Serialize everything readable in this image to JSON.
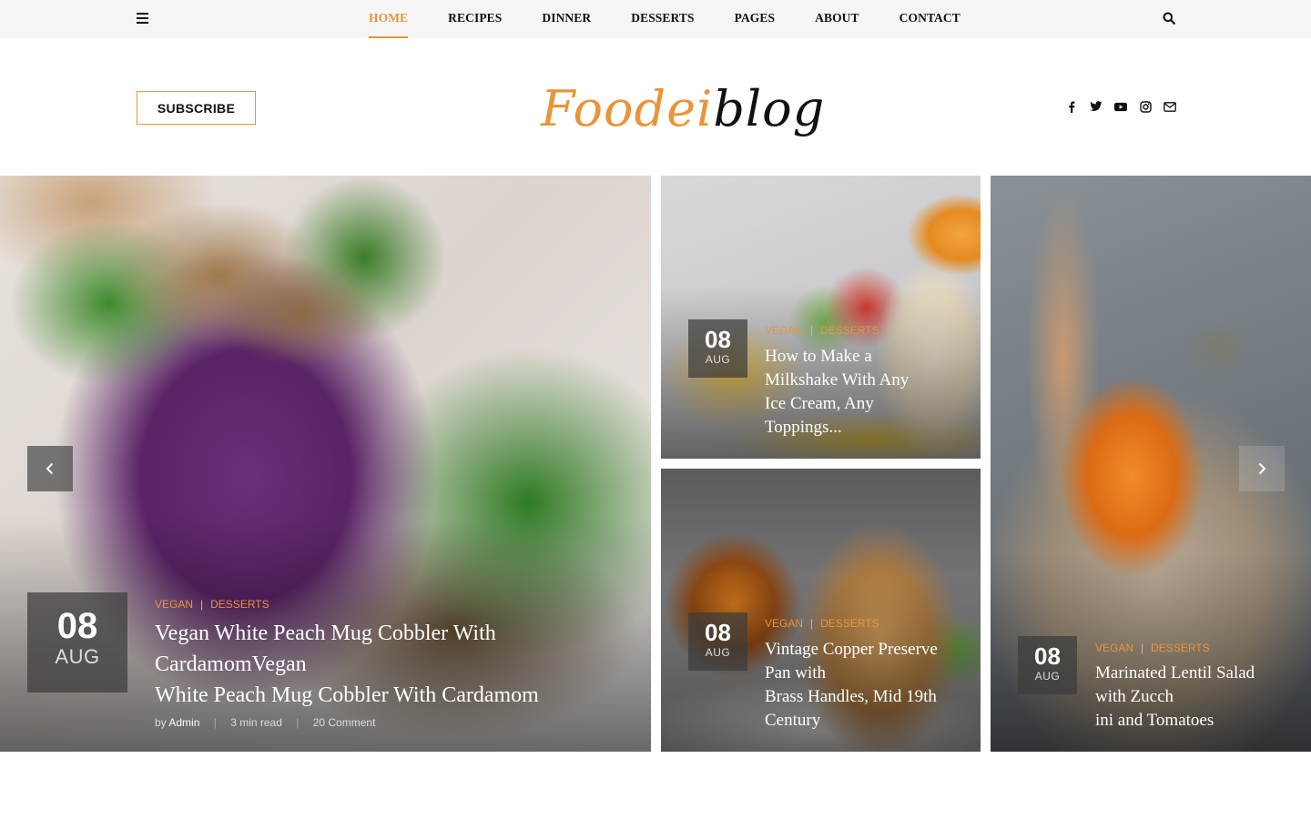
{
  "nav": {
    "menu_icon": "hamburger-icon",
    "items": [
      "HOME",
      "RECIPES",
      "DINNER",
      "DESSERTS",
      "PAGES",
      "ABOUT",
      "CONTACT"
    ],
    "active": "HOME",
    "search_icon": "search-icon"
  },
  "header": {
    "subscribe_label": "SUBSCRIBE",
    "logo_part1": "Foodei",
    "logo_part2": "blog",
    "social_icons": [
      "facebook-icon",
      "twitter-icon",
      "youtube-icon",
      "instagram-icon",
      "envelope-icon"
    ]
  },
  "colors": {
    "accent": "#e8953a",
    "topbar": "#f5f5f5"
  },
  "posts": [
    {
      "day": "08",
      "month": "AUG",
      "cat1": "VEGAN",
      "cat2": "DESSERTS",
      "title": "Vegan White Peach Mug Cobbler With CardamomVegan\nWhite Peach Mug Cobbler With Cardamom",
      "by": "by",
      "author": "Admin",
      "read": "3 min read",
      "comments": "20 Comment"
    },
    {
      "day": "08",
      "month": "AUG",
      "cat1": "VEGAN",
      "cat2": "DESSERTS",
      "title": "How to Make a\nMilkshake With Any\nIce Cream, Any\nToppings..."
    },
    {
      "day": "08",
      "month": "AUG",
      "cat1": "VEGAN",
      "cat2": "DESSERTS",
      "title": "Vintage Copper Preserve\nPan with\nBrass Handles, Mid 19th\nCentury"
    },
    {
      "day": "08",
      "month": "AUG",
      "cat1": "VEGAN",
      "cat2": "DESSERTS",
      "title": "Marinated Lentil Salad\nwith Zucch\nini and Tomatoes"
    }
  ],
  "slider": {
    "prev_icon": "chevron-left-icon",
    "next_icon": "chevron-right-icon"
  }
}
